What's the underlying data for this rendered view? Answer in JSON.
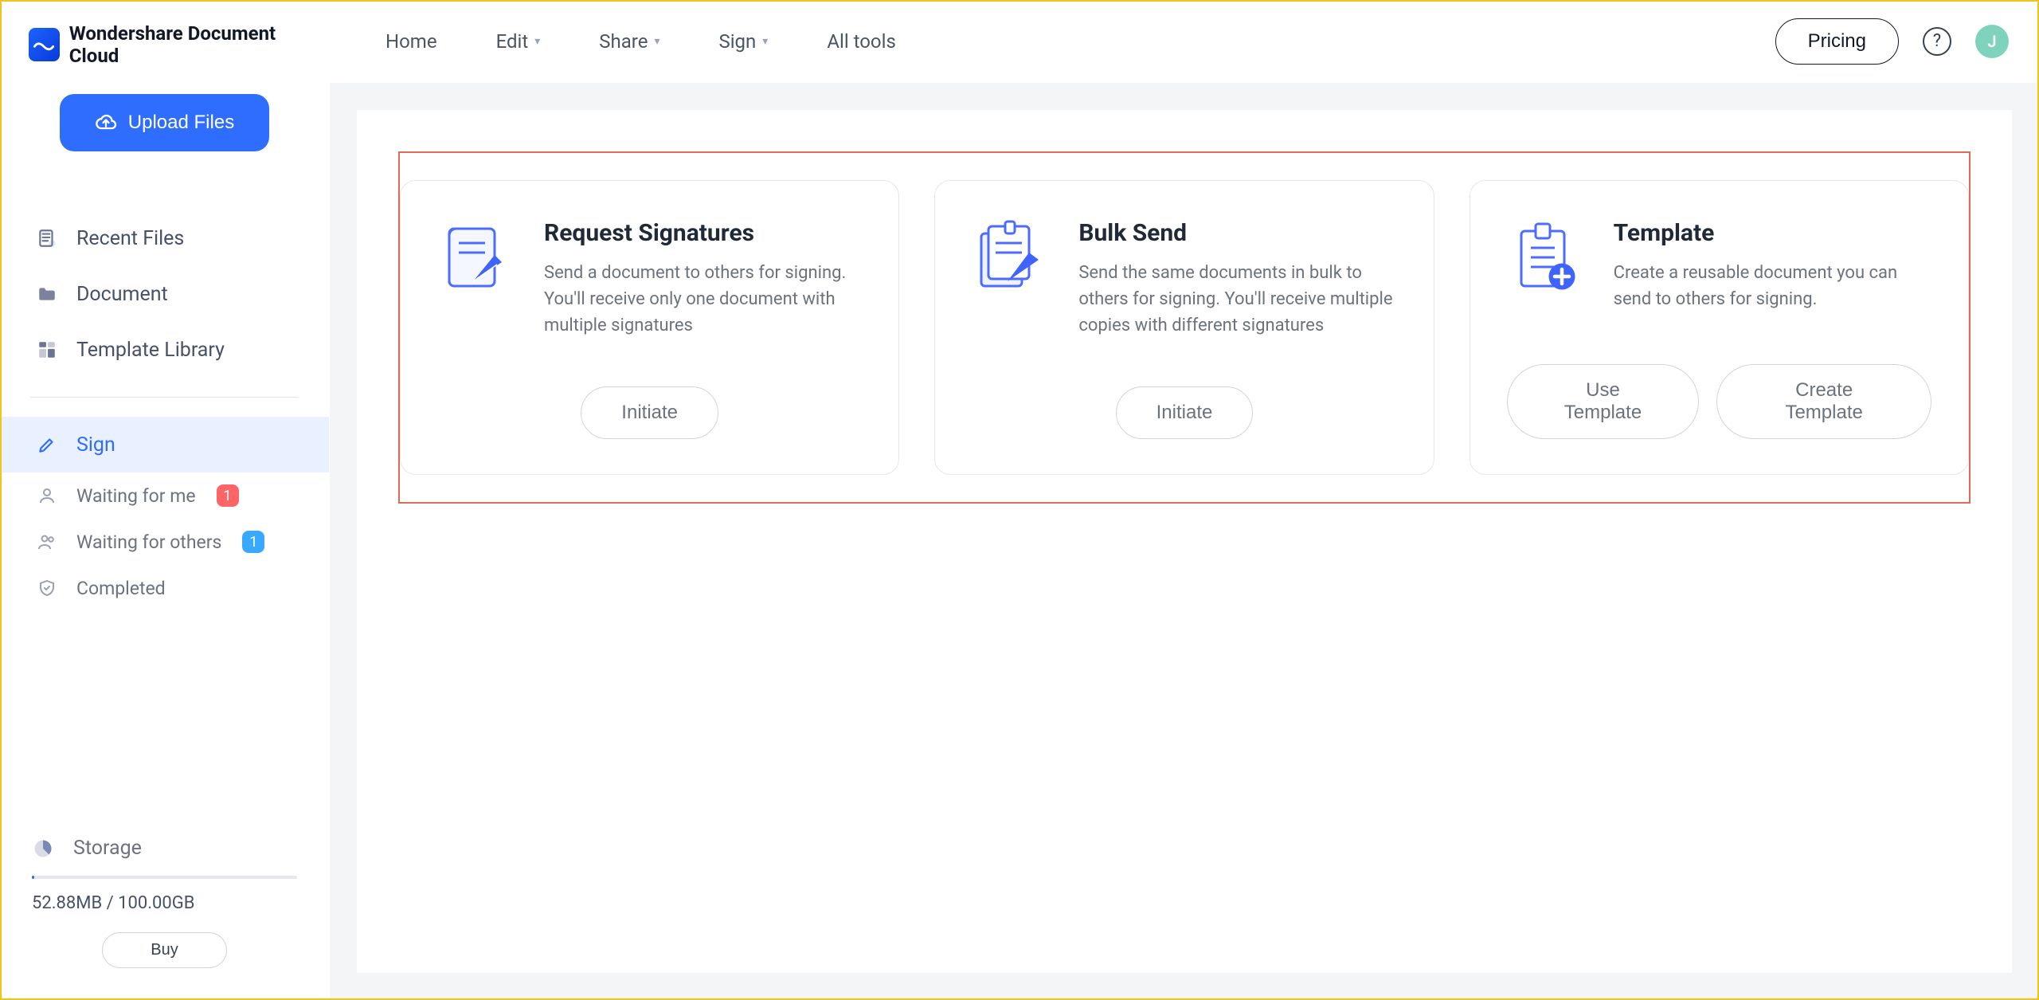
{
  "brand": {
    "name": "Wondershare Document Cloud"
  },
  "sidebar": {
    "upload_label": "Upload Files",
    "nav": {
      "recent": "Recent Files",
      "document": "Document",
      "template_library": "Template Library",
      "sign": "Sign",
      "waiting_me": "Waiting for me",
      "waiting_me_badge": "1",
      "waiting_others": "Waiting for others",
      "waiting_others_badge": "1",
      "completed": "Completed"
    },
    "storage": {
      "label": "Storage",
      "used_text": "52.88MB / 100.00GB",
      "buy_label": "Buy"
    }
  },
  "topnav": {
    "home": "Home",
    "edit": "Edit",
    "share": "Share",
    "sign": "Sign",
    "all_tools": "All tools",
    "pricing": "Pricing",
    "avatar_initial": "J"
  },
  "cards": {
    "request": {
      "title": "Request Signatures",
      "desc": "Send a document to others for signing. You'll receive only one document with multiple signatures",
      "action": "Initiate"
    },
    "bulk": {
      "title": "Bulk Send",
      "desc": "Send the same documents in bulk to others for signing. You'll receive multiple copies with different signatures",
      "action": "Initiate"
    },
    "template": {
      "title": "Template",
      "desc": "Create a reusable document you can send to others for signing.",
      "use": "Use Template",
      "create": "Create Template"
    }
  }
}
